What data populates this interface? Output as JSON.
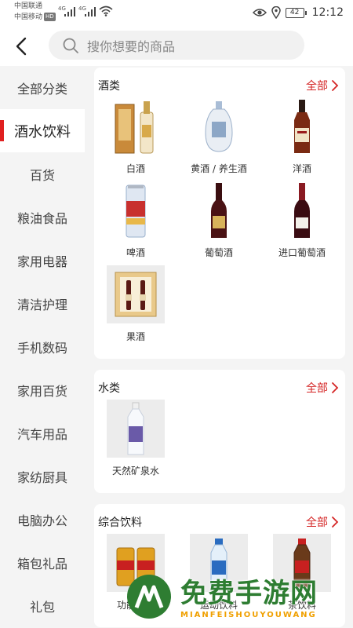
{
  "status_bar": {
    "carrier_1": "中国联通",
    "carrier_2": "中国移动",
    "hd_badge": "HD",
    "network_1": "4G",
    "network_2": "4G",
    "battery": "42",
    "time": "12:12"
  },
  "header": {
    "search_placeholder": "搜你想要的商品"
  },
  "sidebar": {
    "items": [
      {
        "label": "全部分类",
        "active": false
      },
      {
        "label": "酒水饮料",
        "active": true
      },
      {
        "label": "百货",
        "active": false
      },
      {
        "label": "粮油食品",
        "active": false
      },
      {
        "label": "家用电器",
        "active": false
      },
      {
        "label": "清洁护理",
        "active": false
      },
      {
        "label": "手机数码",
        "active": false
      },
      {
        "label": "家用百货",
        "active": false
      },
      {
        "label": "汽车用品",
        "active": false
      },
      {
        "label": "家纺厨具",
        "active": false
      },
      {
        "label": "电脑办公",
        "active": false
      },
      {
        "label": "箱包礼品",
        "active": false
      },
      {
        "label": "礼包",
        "active": false
      }
    ]
  },
  "sections": [
    {
      "title": "酒类",
      "all_label": "全部",
      "products": [
        {
          "name": "白酒",
          "icon": "baijiu-box-icon"
        },
        {
          "name": "黄酒 / 养生酒",
          "icon": "huangjiu-jar-icon"
        },
        {
          "name": "洋酒",
          "icon": "whisky-bottle-icon"
        },
        {
          "name": "啤酒",
          "icon": "beer-can-icon"
        },
        {
          "name": "葡萄酒",
          "icon": "wine-bottle-icon"
        },
        {
          "name": "进口葡萄酒",
          "icon": "imported-wine-icon"
        },
        {
          "name": "果酒",
          "icon": "wine-gift-box-icon"
        }
      ]
    },
    {
      "title": "水类",
      "all_label": "全部",
      "products": [
        {
          "name": "天然矿泉水",
          "icon": "mineral-water-icon"
        }
      ]
    },
    {
      "title": "综合饮料",
      "all_label": "全部",
      "products": [
        {
          "name": "功能饮料",
          "icon": "energy-can-icon"
        },
        {
          "name": "运动饮料",
          "icon": "sports-drink-icon"
        },
        {
          "name": "茶饮料",
          "icon": "tea-drink-icon"
        }
      ]
    }
  ],
  "watermark": {
    "title": "免费手游网",
    "subtitle": "MIANFEISHOUYOUWANG"
  },
  "colors": {
    "accent": "#e02020",
    "link": "#d42525",
    "sidebar_bg": "#f4f4f4"
  }
}
